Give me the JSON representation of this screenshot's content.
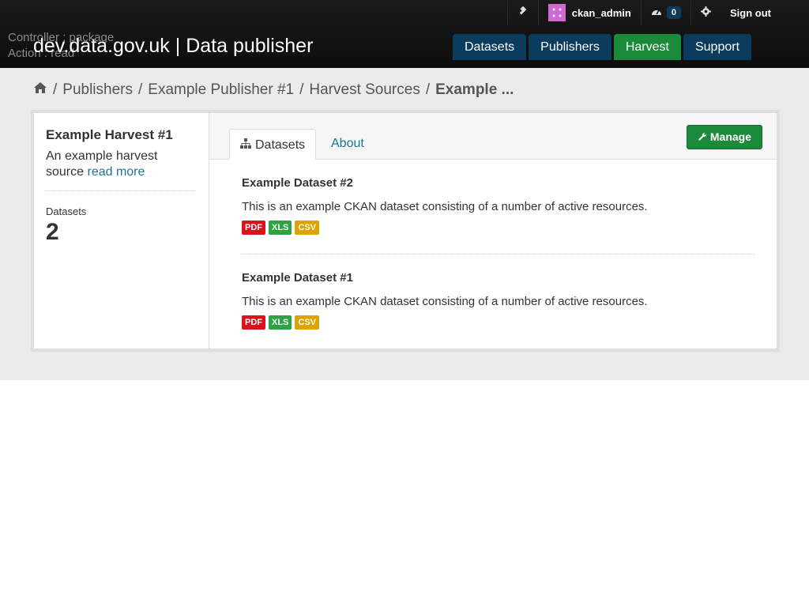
{
  "debug": {
    "controller": "Controller : package",
    "action": "Action : read"
  },
  "site_title": "dev.data.gov.uk | Data publisher",
  "account": {
    "username": "ckan_admin",
    "dashboard_count": "0",
    "sign_out": "Sign out"
  },
  "nav": {
    "datasets": "Datasets",
    "publishers": "Publishers",
    "harvest": "Harvest",
    "support": "Support"
  },
  "breadcrumb": {
    "publishers": "Publishers",
    "publisher": "Example Publisher #1",
    "harvest_sources": "Harvest Sources",
    "current": "Example ...",
    "sep": "/"
  },
  "sidebar": {
    "title": "Example Harvest #1",
    "description": "An example harvest source",
    "read_more": "read more",
    "datasets_label": "Datasets",
    "datasets_count": "2"
  },
  "tabs": {
    "datasets": "Datasets",
    "about": "About"
  },
  "manage_label": "Manage",
  "datasets": [
    {
      "title": "Example Dataset #2",
      "description": "This is an example CKAN dataset consisting of a number of active resources.",
      "formats": [
        "PDF",
        "XLS",
        "CSV"
      ]
    },
    {
      "title": "Example Dataset #1",
      "description": "This is an example CKAN dataset consisting of a number of active resources.",
      "formats": [
        "PDF",
        "XLS",
        "CSV"
      ]
    }
  ]
}
